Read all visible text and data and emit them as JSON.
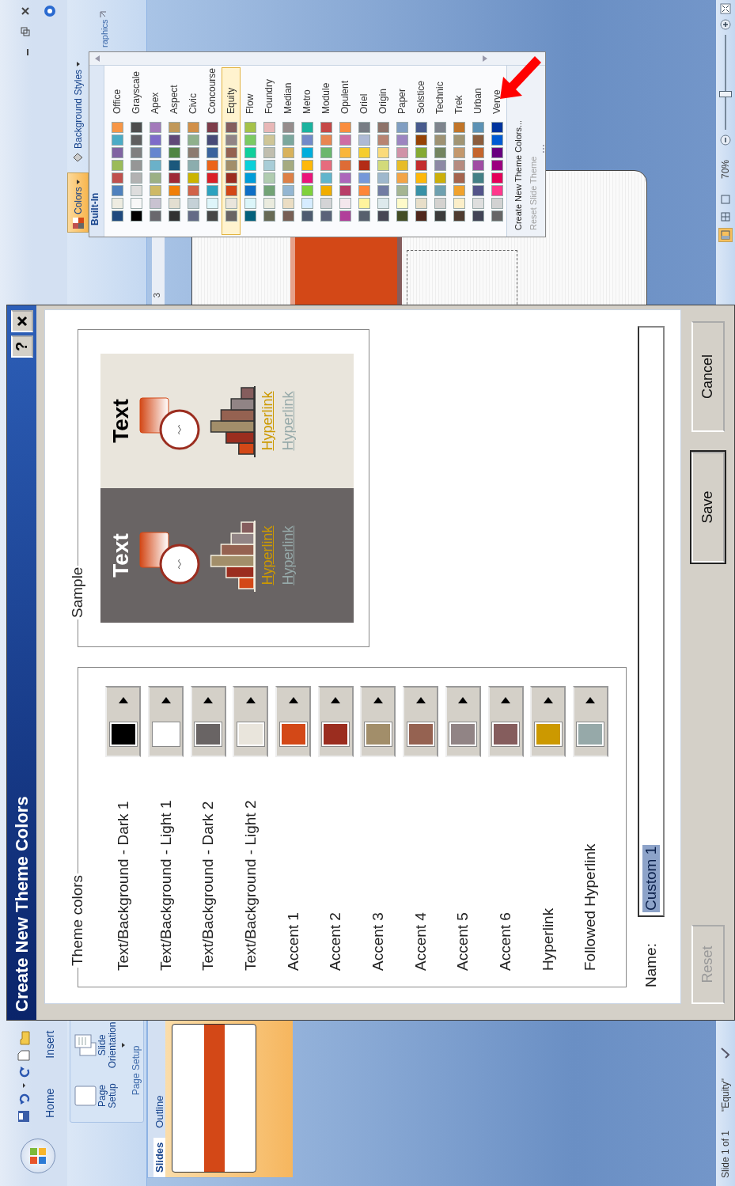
{
  "ribbon": {
    "tabs": [
      {
        "label": "Home",
        "selected": false
      },
      {
        "label": "Insert",
        "selected": false
      }
    ],
    "page_setup": {
      "buttons": [
        {
          "label": "Page Setup",
          "kind": "plain"
        },
        {
          "label": "Slide Orientation",
          "kind": "dropdown"
        }
      ],
      "label": "Page Setup"
    },
    "colors_button": {
      "label": "Colors",
      "pressed": true
    },
    "background_styles_button": {
      "label": "Background Styles"
    },
    "group_label": "raphics"
  },
  "slides_pane": {
    "tabs": [
      {
        "label": "Slides",
        "selected": true
      },
      {
        "label": "Outline",
        "selected": false
      }
    ]
  },
  "ruler": {
    "label": "3"
  },
  "colors_menu": {
    "header": "Built-In",
    "themes": [
      {
        "name": "Office",
        "selected": false,
        "swatches": [
          {
            "color": "#1f497d"
          },
          {
            "color": "#eeece1"
          },
          {
            "color": "#4f81bd"
          },
          {
            "color": "#c0504d"
          },
          {
            "color": "#9bbb59"
          },
          {
            "color": "#8064a2"
          },
          {
            "color": "#4bacc6"
          },
          {
            "color": "#f79646"
          }
        ]
      },
      {
        "name": "Grayscale",
        "selected": false,
        "swatches": [
          {
            "color": "#000000"
          },
          {
            "color": "#f8f8f8"
          },
          {
            "color": "#dddddd"
          },
          {
            "color": "#b2b2b2"
          },
          {
            "color": "#969696"
          },
          {
            "color": "#808080"
          },
          {
            "color": "#5f5f5f"
          },
          {
            "color": "#4d4d4d"
          }
        ]
      },
      {
        "name": "Apex",
        "selected": false,
        "swatches": [
          {
            "color": "#69676d"
          },
          {
            "color": "#c9c2d1"
          },
          {
            "color": "#ceb966"
          },
          {
            "color": "#9cb084"
          },
          {
            "color": "#6bb1c9"
          },
          {
            "color": "#6585cf"
          },
          {
            "color": "#7e6bc9"
          },
          {
            "color": "#a379bb"
          }
        ]
      },
      {
        "name": "Aspect",
        "selected": false,
        "swatches": [
          {
            "color": "#323232"
          },
          {
            "color": "#e3ded1"
          },
          {
            "color": "#f07f09"
          },
          {
            "color": "#9f2936"
          },
          {
            "color": "#1b587c"
          },
          {
            "color": "#4e8542"
          },
          {
            "color": "#604878"
          },
          {
            "color": "#c19859"
          }
        ]
      },
      {
        "name": "Civic",
        "selected": false,
        "swatches": [
          {
            "color": "#646b86"
          },
          {
            "color": "#c5d1d7"
          },
          {
            "color": "#d16349"
          },
          {
            "color": "#ccb400"
          },
          {
            "color": "#8cadae"
          },
          {
            "color": "#8c7b70"
          },
          {
            "color": "#8fb08c"
          },
          {
            "color": "#d19049"
          }
        ]
      },
      {
        "name": "Concourse",
        "selected": false,
        "swatches": [
          {
            "color": "#464646"
          },
          {
            "color": "#def5fa"
          },
          {
            "color": "#2da2bf"
          },
          {
            "color": "#da1f28"
          },
          {
            "color": "#eb641b"
          },
          {
            "color": "#39639d"
          },
          {
            "color": "#474b78"
          },
          {
            "color": "#7d3c4a"
          }
        ]
      },
      {
        "name": "Equity",
        "selected": true,
        "swatches": [
          {
            "color": "#696464"
          },
          {
            "color": "#e9e5dc"
          },
          {
            "color": "#d34817"
          },
          {
            "color": "#9b2d1f"
          },
          {
            "color": "#a28e6a"
          },
          {
            "color": "#956251"
          },
          {
            "color": "#918485"
          },
          {
            "color": "#855d5d"
          }
        ]
      },
      {
        "name": "Flow",
        "selected": false,
        "swatches": [
          {
            "color": "#04617b"
          },
          {
            "color": "#dbf5f9"
          },
          {
            "color": "#0f6fc6"
          },
          {
            "color": "#009dd9"
          },
          {
            "color": "#0bd0d9"
          },
          {
            "color": "#10cf9b"
          },
          {
            "color": "#7cca62"
          },
          {
            "color": "#a5c249"
          }
        ]
      },
      {
        "name": "Foundry",
        "selected": false,
        "swatches": [
          {
            "color": "#676a55"
          },
          {
            "color": "#eaebde"
          },
          {
            "color": "#72a376"
          },
          {
            "color": "#b0ccb0"
          },
          {
            "color": "#a8cdd7"
          },
          {
            "color": "#c0beaf"
          },
          {
            "color": "#cec597"
          },
          {
            "color": "#e8b7b7"
          }
        ]
      },
      {
        "name": "Median",
        "selected": false,
        "swatches": [
          {
            "color": "#775f55"
          },
          {
            "color": "#ebddc3"
          },
          {
            "color": "#94b6d2"
          },
          {
            "color": "#dd8047"
          },
          {
            "color": "#a5ab81"
          },
          {
            "color": "#d8b25c"
          },
          {
            "color": "#7ba79d"
          },
          {
            "color": "#968c8c"
          }
        ]
      },
      {
        "name": "Metro",
        "selected": false,
        "swatches": [
          {
            "color": "#4e5b6f"
          },
          {
            "color": "#d6ecff"
          },
          {
            "color": "#7fd13b"
          },
          {
            "color": "#ea157a"
          },
          {
            "color": "#feb80a"
          },
          {
            "color": "#00addc"
          },
          {
            "color": "#738ac8"
          },
          {
            "color": "#1ab39f"
          }
        ]
      },
      {
        "name": "Module",
        "selected": false,
        "swatches": [
          {
            "color": "#5a6378"
          },
          {
            "color": "#d4d4d6"
          },
          {
            "color": "#f0ad00"
          },
          {
            "color": "#60b5cc"
          },
          {
            "color": "#e66c7d"
          },
          {
            "color": "#6bb76d"
          },
          {
            "color": "#e88651"
          },
          {
            "color": "#c64847"
          }
        ]
      },
      {
        "name": "Opulent",
        "selected": false,
        "swatches": [
          {
            "color": "#b13f9a"
          },
          {
            "color": "#f4e7ed"
          },
          {
            "color": "#b83d68"
          },
          {
            "color": "#ac66bb"
          },
          {
            "color": "#de6c36"
          },
          {
            "color": "#f9b639"
          },
          {
            "color": "#cf6da4"
          },
          {
            "color": "#fa8d3d"
          }
        ]
      },
      {
        "name": "Oriel",
        "selected": false,
        "swatches": [
          {
            "color": "#575f6d"
          },
          {
            "color": "#fff39d"
          },
          {
            "color": "#fe8637"
          },
          {
            "color": "#7598d9"
          },
          {
            "color": "#b32c16"
          },
          {
            "color": "#f5cd2d"
          },
          {
            "color": "#aebad5"
          },
          {
            "color": "#777c84"
          }
        ]
      },
      {
        "name": "Origin",
        "selected": false,
        "swatches": [
          {
            "color": "#464653"
          },
          {
            "color": "#dde9ec"
          },
          {
            "color": "#727ca3"
          },
          {
            "color": "#9fb8cd"
          },
          {
            "color": "#d2da7a"
          },
          {
            "color": "#fada7a"
          },
          {
            "color": "#b88472"
          },
          {
            "color": "#8e736a"
          }
        ]
      },
      {
        "name": "Paper",
        "selected": false,
        "swatches": [
          {
            "color": "#444d26"
          },
          {
            "color": "#fefac9"
          },
          {
            "color": "#a5b592"
          },
          {
            "color": "#f3a447"
          },
          {
            "color": "#e7bc29"
          },
          {
            "color": "#d092a7"
          },
          {
            "color": "#9c85c0"
          },
          {
            "color": "#809ec2"
          }
        ]
      },
      {
        "name": "Solstice",
        "selected": false,
        "swatches": [
          {
            "color": "#4f271c"
          },
          {
            "color": "#e7dec9"
          },
          {
            "color": "#3891a7"
          },
          {
            "color": "#feb80a"
          },
          {
            "color": "#c32d2e"
          },
          {
            "color": "#84aa33"
          },
          {
            "color": "#964305"
          },
          {
            "color": "#475a8d"
          }
        ]
      },
      {
        "name": "Technic",
        "selected": false,
        "swatches": [
          {
            "color": "#3b3b3b"
          },
          {
            "color": "#d4d2d0"
          },
          {
            "color": "#6ea0b0"
          },
          {
            "color": "#ccaf0a"
          },
          {
            "color": "#8d89a4"
          },
          {
            "color": "#748560"
          },
          {
            "color": "#9e9273"
          },
          {
            "color": "#7e848d"
          }
        ]
      },
      {
        "name": "Trek",
        "selected": false,
        "swatches": [
          {
            "color": "#4e3b30"
          },
          {
            "color": "#fbeec9"
          },
          {
            "color": "#f0a22e"
          },
          {
            "color": "#a5644e"
          },
          {
            "color": "#b58b80"
          },
          {
            "color": "#c3986d"
          },
          {
            "color": "#a19574"
          },
          {
            "color": "#c17529"
          }
        ]
      },
      {
        "name": "Urban",
        "selected": false,
        "swatches": [
          {
            "color": "#424456"
          },
          {
            "color": "#dedede"
          },
          {
            "color": "#53548a"
          },
          {
            "color": "#438086"
          },
          {
            "color": "#a04da3"
          },
          {
            "color": "#c4652d"
          },
          {
            "color": "#8b5d3d"
          },
          {
            "color": "#5c92b5"
          }
        ]
      },
      {
        "name": "Verve",
        "selected": false,
        "swatches": [
          {
            "color": "#666666"
          },
          {
            "color": "#d2d2d2"
          },
          {
            "color": "#ff388c"
          },
          {
            "color": "#e40059"
          },
          {
            "color": "#9c007f"
          },
          {
            "color": "#68007f"
          },
          {
            "color": "#005bd3"
          },
          {
            "color": "#00349e"
          }
        ]
      }
    ],
    "items": [
      {
        "label": "Create New Theme Colors...",
        "disabled": false
      },
      {
        "label": "Reset Slide Theme",
        "disabled": true
      }
    ]
  },
  "dialog": {
    "title": "Create New Theme Colors",
    "help": "?",
    "theme_colors": {
      "legend": "Theme colors",
      "rows": [
        {
          "label": "Text/Background - Dark 1",
          "color": "#000000"
        },
        {
          "label": "Text/Background - Light 1",
          "color": "#ffffff"
        },
        {
          "label": "Text/Background - Dark 2",
          "color": "#696464"
        },
        {
          "label": "Text/Background - Light 2",
          "color": "#e9e5dc"
        },
        {
          "label": "Accent 1",
          "color": "#d34817"
        },
        {
          "label": "Accent 2",
          "color": "#9b2d1f"
        },
        {
          "label": "Accent 3",
          "color": "#a28e6a"
        },
        {
          "label": "Accent 4",
          "color": "#956251"
        },
        {
          "label": "Accent 5",
          "color": "#918485"
        },
        {
          "label": "Accent 6",
          "color": "#855d5d"
        },
        {
          "label": "Hyperlink",
          "color": "#cc9900"
        },
        {
          "label": "Followed Hyperlink",
          "color": "#96a9a9"
        }
      ]
    },
    "sample": {
      "legend": "Sample",
      "panels": [
        {
          "kind": "dark",
          "heading": "Text",
          "links": [
            "Hyperlink",
            "Hyperlink"
          ]
        },
        {
          "kind": "light",
          "heading": "Text",
          "links": [
            "Hyperlink",
            "Hyperlink"
          ]
        }
      ]
    },
    "name": {
      "label": "Name:",
      "value": "Custom 1",
      "highlighted": true
    },
    "buttons": [
      {
        "label": "Reset",
        "disabled": true,
        "default": false
      },
      {
        "label": "Save",
        "disabled": false,
        "default": true
      },
      {
        "label": "Cancel",
        "disabled": false,
        "default": false
      }
    ]
  },
  "status_bar": {
    "slide": "Slide 1 of 1",
    "theme": "\"Equity\"",
    "views": [
      {
        "selected": true
      },
      {
        "selected": false
      },
      {
        "selected": false
      }
    ],
    "zoom": "70%",
    "zoom_slider": {
      "level": 0.37
    }
  }
}
